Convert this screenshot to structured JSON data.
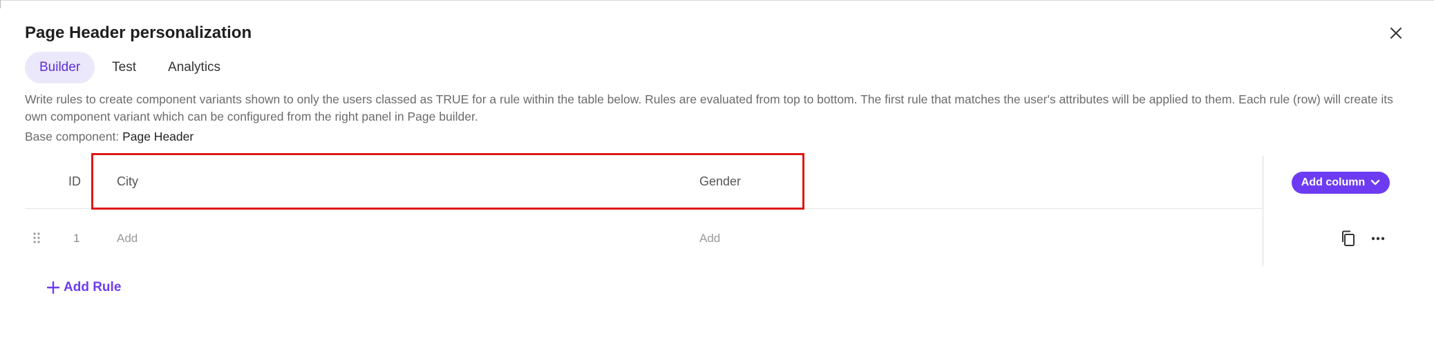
{
  "dialog": {
    "title": "Page Header personalization",
    "close_icon": "close-icon"
  },
  "tabs": [
    {
      "label": "Builder",
      "active": true
    },
    {
      "label": "Test",
      "active": false
    },
    {
      "label": "Analytics",
      "active": false
    }
  ],
  "description": "Write rules to create component variants shown to only the users classed as TRUE for a rule within the table below. Rules are evaluated from top to bottom. The first rule that matches the user's attributes will be applied to them. Each rule (row) will create its own component variant which can be configured from the right panel in Page builder.",
  "base_component": {
    "label": "Base component:",
    "value": "Page Header"
  },
  "table": {
    "columns": [
      {
        "label": "ID"
      },
      {
        "label": "City"
      },
      {
        "label": "Gender"
      }
    ],
    "add_column_label": "Add column",
    "rows": [
      {
        "id": "1",
        "city_placeholder": "Add",
        "gender_placeholder": "Add"
      }
    ]
  },
  "add_rule_label": "Add Rule",
  "colors": {
    "accent": "#6d3cf2",
    "tab_active_bg": "#ece8fb",
    "highlight": "#e01616"
  }
}
